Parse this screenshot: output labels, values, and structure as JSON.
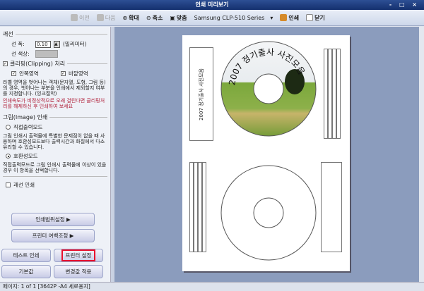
{
  "window": {
    "title": "인쇄 미리보기",
    "controls": "- □ ×"
  },
  "toolbar": {
    "prev": "이전",
    "next": "다음",
    "zoom_in": "확대",
    "zoom_out": "축소",
    "fit": "맞춤",
    "printer": "Samsung CLP-510 Series",
    "print": "인쇄",
    "close": "닫기"
  },
  "line": {
    "group": "괘선",
    "width_label": "선 폭:",
    "width_value": "0.10",
    "unit": "(밀리미터)",
    "color_label": "선 색상:"
  },
  "clip": {
    "group": "클리핑(Clipping) 처리",
    "inside": "안쪽영역",
    "outside": "바깥영역",
    "desc": "라벨 영역을 벗어나는 객체(문자열, 도형, 그림 등)의 경우, 벗어나는 부분을 인쇄에서 제외할지 여부를 지정합니다. (잉크절약)",
    "warn": "인쇄속도가 비정상적으로 오래 걸린다면 클리핑처리를 해제하신 후 인쇄하여 보세요"
  },
  "image": {
    "group": "그림(Image) 인쇄",
    "direct": "직접출력모드",
    "direct_desc": "그림 인쇄시 출력물에 특별한 문제점이 없을 때 사용하며 호환성모드보다 출력시간과 화질에서 다소 유리할 수 있습니다.",
    "compat": "호환성모드",
    "compat_desc": "직접출력모드로 그림 인쇄시 출력물에 이상이 있을경우 이 항목을 선택합니다."
  },
  "border_print": "괘선 인쇄",
  "buttons": {
    "range": "인쇄범위설정 ▶",
    "margin": "프린터 여백조정 ▶",
    "test": "테스트 인쇄",
    "printer_setup": "프린터 설정",
    "default": "기본값",
    "apply": "변경값 적용"
  },
  "label": {
    "disc_title": "2007 정기출사 사진모음",
    "spine": "2007 정기출사 사진모음"
  },
  "status": "페이지: 1 of 1 [3642P -A4 세로용지]",
  "colors": {
    "highlight": "#e8102e"
  }
}
